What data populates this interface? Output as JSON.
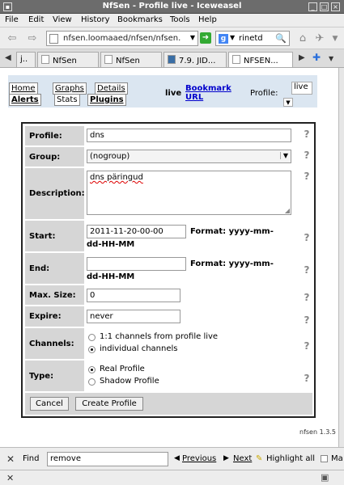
{
  "window": {
    "title": "NfSen - Profile live - Iceweasel"
  },
  "menu": [
    "File",
    "Edit",
    "View",
    "History",
    "Bookmarks",
    "Tools",
    "Help"
  ],
  "nav": {
    "url": "nfsen.loomaaed/nfsen/nfsen.",
    "search_engine_icon": "google-icon",
    "search_text": "rinetd"
  },
  "tabs": [
    {
      "label": "j.."
    },
    {
      "label": "NfSen"
    },
    {
      "label": "NfSen"
    },
    {
      "label": "7.9. JID..."
    },
    {
      "label": "NFSEN..."
    }
  ],
  "nfsen_nav": {
    "tabs_top": [
      "Home",
      "Graphs",
      "Details"
    ],
    "tabs_bottom": [
      "Alerts",
      "Stats",
      "Plugins"
    ],
    "live": "live",
    "bookmark_1": "Bookmark",
    "bookmark_2": "URL",
    "profile_label": "Profile:",
    "profile_value": "live"
  },
  "form": {
    "profile_label": "Profile:",
    "profile_value": "dns",
    "group_label": "Group:",
    "group_value": "(nogroup)",
    "description_label": "Description:",
    "description_value": "dns päringud",
    "start_label": "Start:",
    "start_value": "2011-11-20-00-00",
    "format_label": "Format: yyyy-mm-",
    "format_label_cont": "dd-HH-MM",
    "end_label": "End:",
    "end_value": "",
    "maxsize_label": "Max. Size:",
    "maxsize_value": "0",
    "expire_label": "Expire:",
    "expire_value": "never",
    "channels_label": "Channels:",
    "channels_opt1": "1:1 channels from profile live",
    "channels_opt2": "individual channels",
    "type_label": "Type:",
    "type_opt1": "Real Profile",
    "type_opt2": "Shadow Profile",
    "cancel": "Cancel",
    "create": "Create Profile"
  },
  "version": "nfsen 1.3.5",
  "findbar": {
    "label": "Find",
    "value": "remove",
    "previous": "Previous",
    "next": "Next",
    "highlight": "Highlight all",
    "match_case": "Ma"
  }
}
